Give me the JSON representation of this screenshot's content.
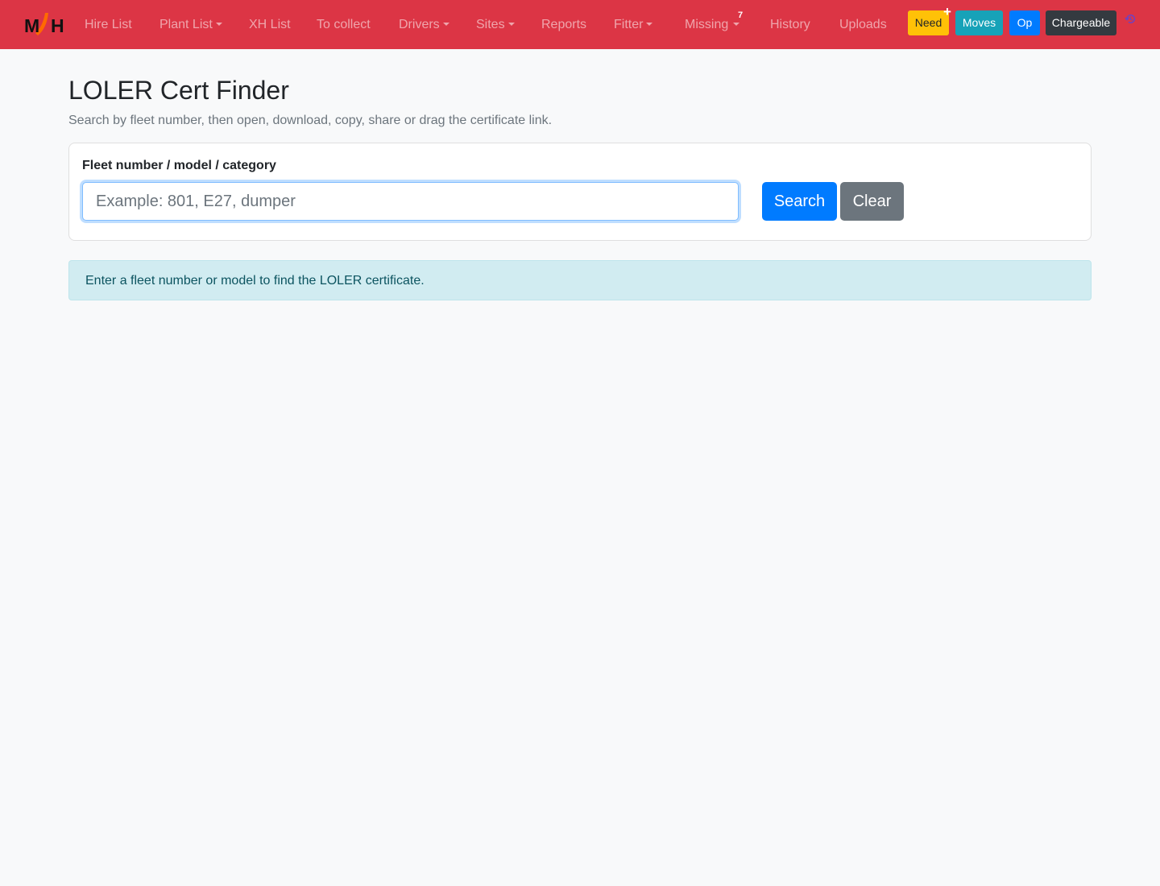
{
  "brand": {
    "logo_text": "MJH",
    "colors": {
      "navbar": "#dc3545",
      "logo_letters": "#111111",
      "logo_accent": "#ff6a00"
    }
  },
  "nav": {
    "items": [
      {
        "label": "Hire List",
        "dropdown": false
      },
      {
        "label": "Plant List",
        "dropdown": true
      },
      {
        "label": "XH List",
        "dropdown": false
      },
      {
        "label": "To collect",
        "dropdown": false
      },
      {
        "label": "Drivers",
        "dropdown": true
      },
      {
        "label": "Sites",
        "dropdown": true
      },
      {
        "label": "Reports",
        "dropdown": false
      },
      {
        "label": "Fitter",
        "dropdown": true
      },
      {
        "label": "Missing",
        "dropdown": true,
        "badge": "7"
      },
      {
        "label": "History",
        "dropdown": false
      },
      {
        "label": "Uploads",
        "dropdown": false
      }
    ],
    "buttons": {
      "need": "Need",
      "moves": "Moves",
      "op": "Op",
      "chargeable": "Chargeable"
    },
    "icons": {
      "plus": "plus-icon",
      "history": "history-icon"
    }
  },
  "page": {
    "title": "LOLER Cert Finder",
    "subtitle": "Search by fleet number, then open, download, copy, share or drag the certificate link."
  },
  "search": {
    "label": "Fleet number / model / category",
    "value": "",
    "placeholder": "Example: 801, E27, dumper",
    "search_button": "Search",
    "clear_button": "Clear"
  },
  "alert": {
    "text": "Enter a fleet number or model to find the LOLER certificate.",
    "type": "info"
  }
}
